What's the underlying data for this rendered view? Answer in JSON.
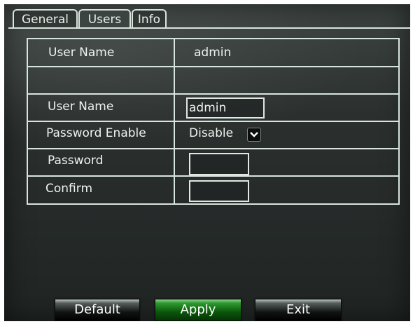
{
  "tabs": [
    {
      "label": "General",
      "active": false
    },
    {
      "label": "Users",
      "active": true
    },
    {
      "label": "Info",
      "active": false
    }
  ],
  "current_user": {
    "label": "User Name",
    "value": "admin"
  },
  "form": {
    "user_name": {
      "label": "User Name",
      "value": "admin"
    },
    "password_enable": {
      "label": "Password Enable",
      "value": "Disable"
    },
    "password": {
      "label": "Password",
      "value": ""
    },
    "confirm": {
      "label": "Confirm",
      "value": ""
    }
  },
  "buttons": {
    "default_label": "Default",
    "apply_label": "Apply",
    "exit_label": "Exit"
  },
  "colors": {
    "panel_background": "#2b302f",
    "grid_lines": "#d8e4de",
    "apply_button": "#2c9a2c",
    "default_button": "#111413"
  }
}
